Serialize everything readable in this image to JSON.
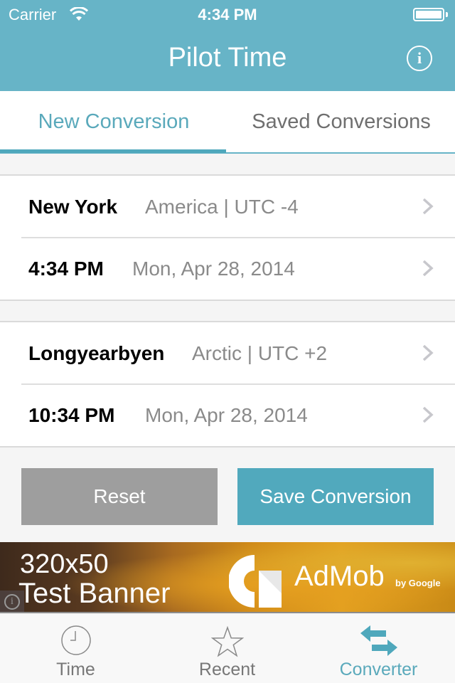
{
  "status_bar": {
    "carrier": "Carrier",
    "time": "4:34 PM",
    "wifi_icon": "wifi-icon",
    "battery_icon": "battery-full-icon",
    "battery_level": 1.0
  },
  "header": {
    "title": "Pilot Time",
    "info_icon": "info-icon",
    "info_glyph": "i"
  },
  "tabs": [
    {
      "label": "New Conversion",
      "active": true
    },
    {
      "label": "Saved Conversions",
      "active": false
    }
  ],
  "conversions": {
    "from": {
      "city": "New York",
      "zone": "America | UTC -4",
      "time": "4:34 PM",
      "date": "Mon, Apr 28, 2014"
    },
    "to": {
      "city": "Longyearbyen",
      "zone": "Arctic | UTC +2",
      "time": "10:34 PM",
      "date": "Mon, Apr 28, 2014"
    }
  },
  "buttons": {
    "reset": "Reset",
    "save": "Save Conversion"
  },
  "ad": {
    "line1": "320x50",
    "line2": "Test Banner",
    "brand": "AdMob",
    "byline": "by Google",
    "info_glyph": "i"
  },
  "tabbar": [
    {
      "label": "Time",
      "icon": "clock-icon",
      "active": false
    },
    {
      "label": "Recent",
      "icon": "star-icon",
      "active": false
    },
    {
      "label": "Converter",
      "icon": "swap-arrows-icon",
      "active": true
    }
  ],
  "colors": {
    "brand": "#67b4c7",
    "accent": "#51a9bd",
    "reset_button": "#9e9e9e",
    "inactive_text": "#777777"
  }
}
